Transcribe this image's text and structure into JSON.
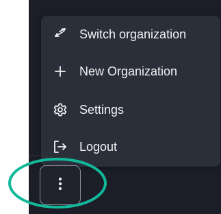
{
  "menu": {
    "items": [
      {
        "label": "Switch organization",
        "icon": "switch-arrows-icon"
      },
      {
        "label": "New Organization",
        "icon": "plus-icon"
      },
      {
        "label": "Settings",
        "icon": "gear-icon"
      },
      {
        "label": "Logout",
        "icon": "logout-icon"
      }
    ]
  },
  "more_button": {
    "icon": "vertical-ellipsis-icon"
  },
  "annotation": {
    "color": "#12b89a"
  },
  "colors": {
    "app_background": "#1b1e27",
    "menu_background": "#2b2f3a",
    "text": "#f1f2f4"
  }
}
